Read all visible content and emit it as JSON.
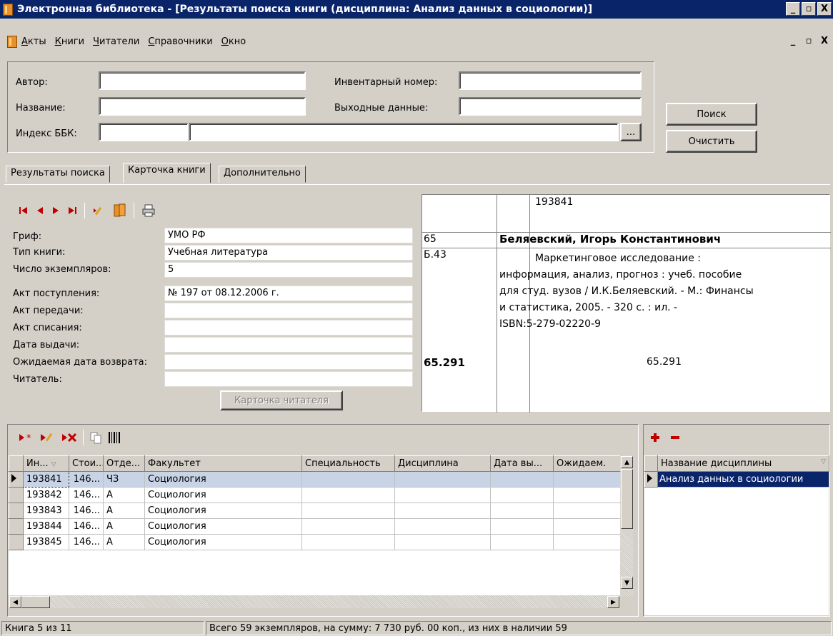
{
  "window": {
    "title": "Электронная библиотека - [Результаты поиска книги (дисциплина: Анализ данных в социологии)]",
    "min_glyph": "_",
    "restore_glyph": "▫",
    "close_glyph": "X"
  },
  "menu": [
    "Акты",
    "Книги",
    "Читатели",
    "Справочники",
    "Окно"
  ],
  "search": {
    "author_label": "Автор:",
    "author_value": "",
    "title_label": "Название:",
    "title_value": "",
    "bbk_label": "Индекс ББК:",
    "bbk_code": "",
    "bbk_text": "",
    "browse_label": "...",
    "inventory_label": "Инвентарный номер:",
    "inventory_value": "",
    "imprint_label": "Выходные данные:",
    "imprint_value": "",
    "search_button": "Поиск",
    "clear_button": "Очистить"
  },
  "tabs": [
    "Результаты поиска",
    "Карточка книги",
    "Дополнительно"
  ],
  "active_tab": 1,
  "card_fields": [
    {
      "label": "Гриф:",
      "value": "УМО РФ"
    },
    {
      "label": "Тип книги:",
      "value": "Учебная литература"
    },
    {
      "label": "Число экземпляров:",
      "value": "5"
    },
    {
      "label": "Акт поступления:",
      "value": "№ 197 от 08.12.2006 г."
    },
    {
      "label": "Акт передачи:",
      "value": ""
    },
    {
      "label": "Акт списания:",
      "value": ""
    },
    {
      "label": "Дата выдачи:",
      "value": ""
    },
    {
      "label": "Ожидаемая дата возврата:",
      "value": ""
    },
    {
      "label": "Читатель:",
      "value": ""
    }
  ],
  "reader_card_button": "Карточка читателя",
  "catalog_card": {
    "inventory": "193841",
    "code1": "65",
    "author": "Беляевский, Игорь Константинович",
    "code2": "Б.43",
    "description_lines": [
      "Маркетинговое исследование :",
      "информация, анализ, прогноз : учеб. пособие",
      "для студ. вузов / И.К.Беляевский. - М.: Финансы",
      "и статистика, 2005. - 320 с. : ил. -",
      "ISBN:5-279-02220-9"
    ],
    "bbk_bold": "65.291",
    "bbk_right": "65.291"
  },
  "copies_grid": {
    "columns": [
      "Ин...",
      "Стои...",
      "Отде...",
      "Факультет",
      "Специальность",
      "Дисциплина",
      "Дата вы...",
      "Ожидаем."
    ],
    "rows": [
      [
        "193841",
        "146...",
        "ЧЗ",
        "Социология",
        "",
        "",
        "",
        ""
      ],
      [
        "193842",
        "146...",
        "А",
        "Социология",
        "",
        "",
        "",
        ""
      ],
      [
        "193843",
        "146...",
        "А",
        "Социология",
        "",
        "",
        "",
        ""
      ],
      [
        "193844",
        "146...",
        "А",
        "Социология",
        "",
        "",
        "",
        ""
      ],
      [
        "193845",
        "146...",
        "А",
        "Социология",
        "",
        "",
        "",
        ""
      ]
    ]
  },
  "disciplines_grid": {
    "column": "Название дисциплины",
    "rows": [
      "Анализ данных в социологии"
    ]
  },
  "status": {
    "position": "Книга 5 из 11",
    "summary": "Всего 59 экземпляров, на сумму: 7 730 руб. 00 коп., из них в наличии 59"
  },
  "colors": {
    "titlebar": "#0a246a",
    "face": "#d4d0c8",
    "selection": "#c8d4e6",
    "nav_arrow": "#c00000",
    "discipline_selection": "#0a246a"
  }
}
